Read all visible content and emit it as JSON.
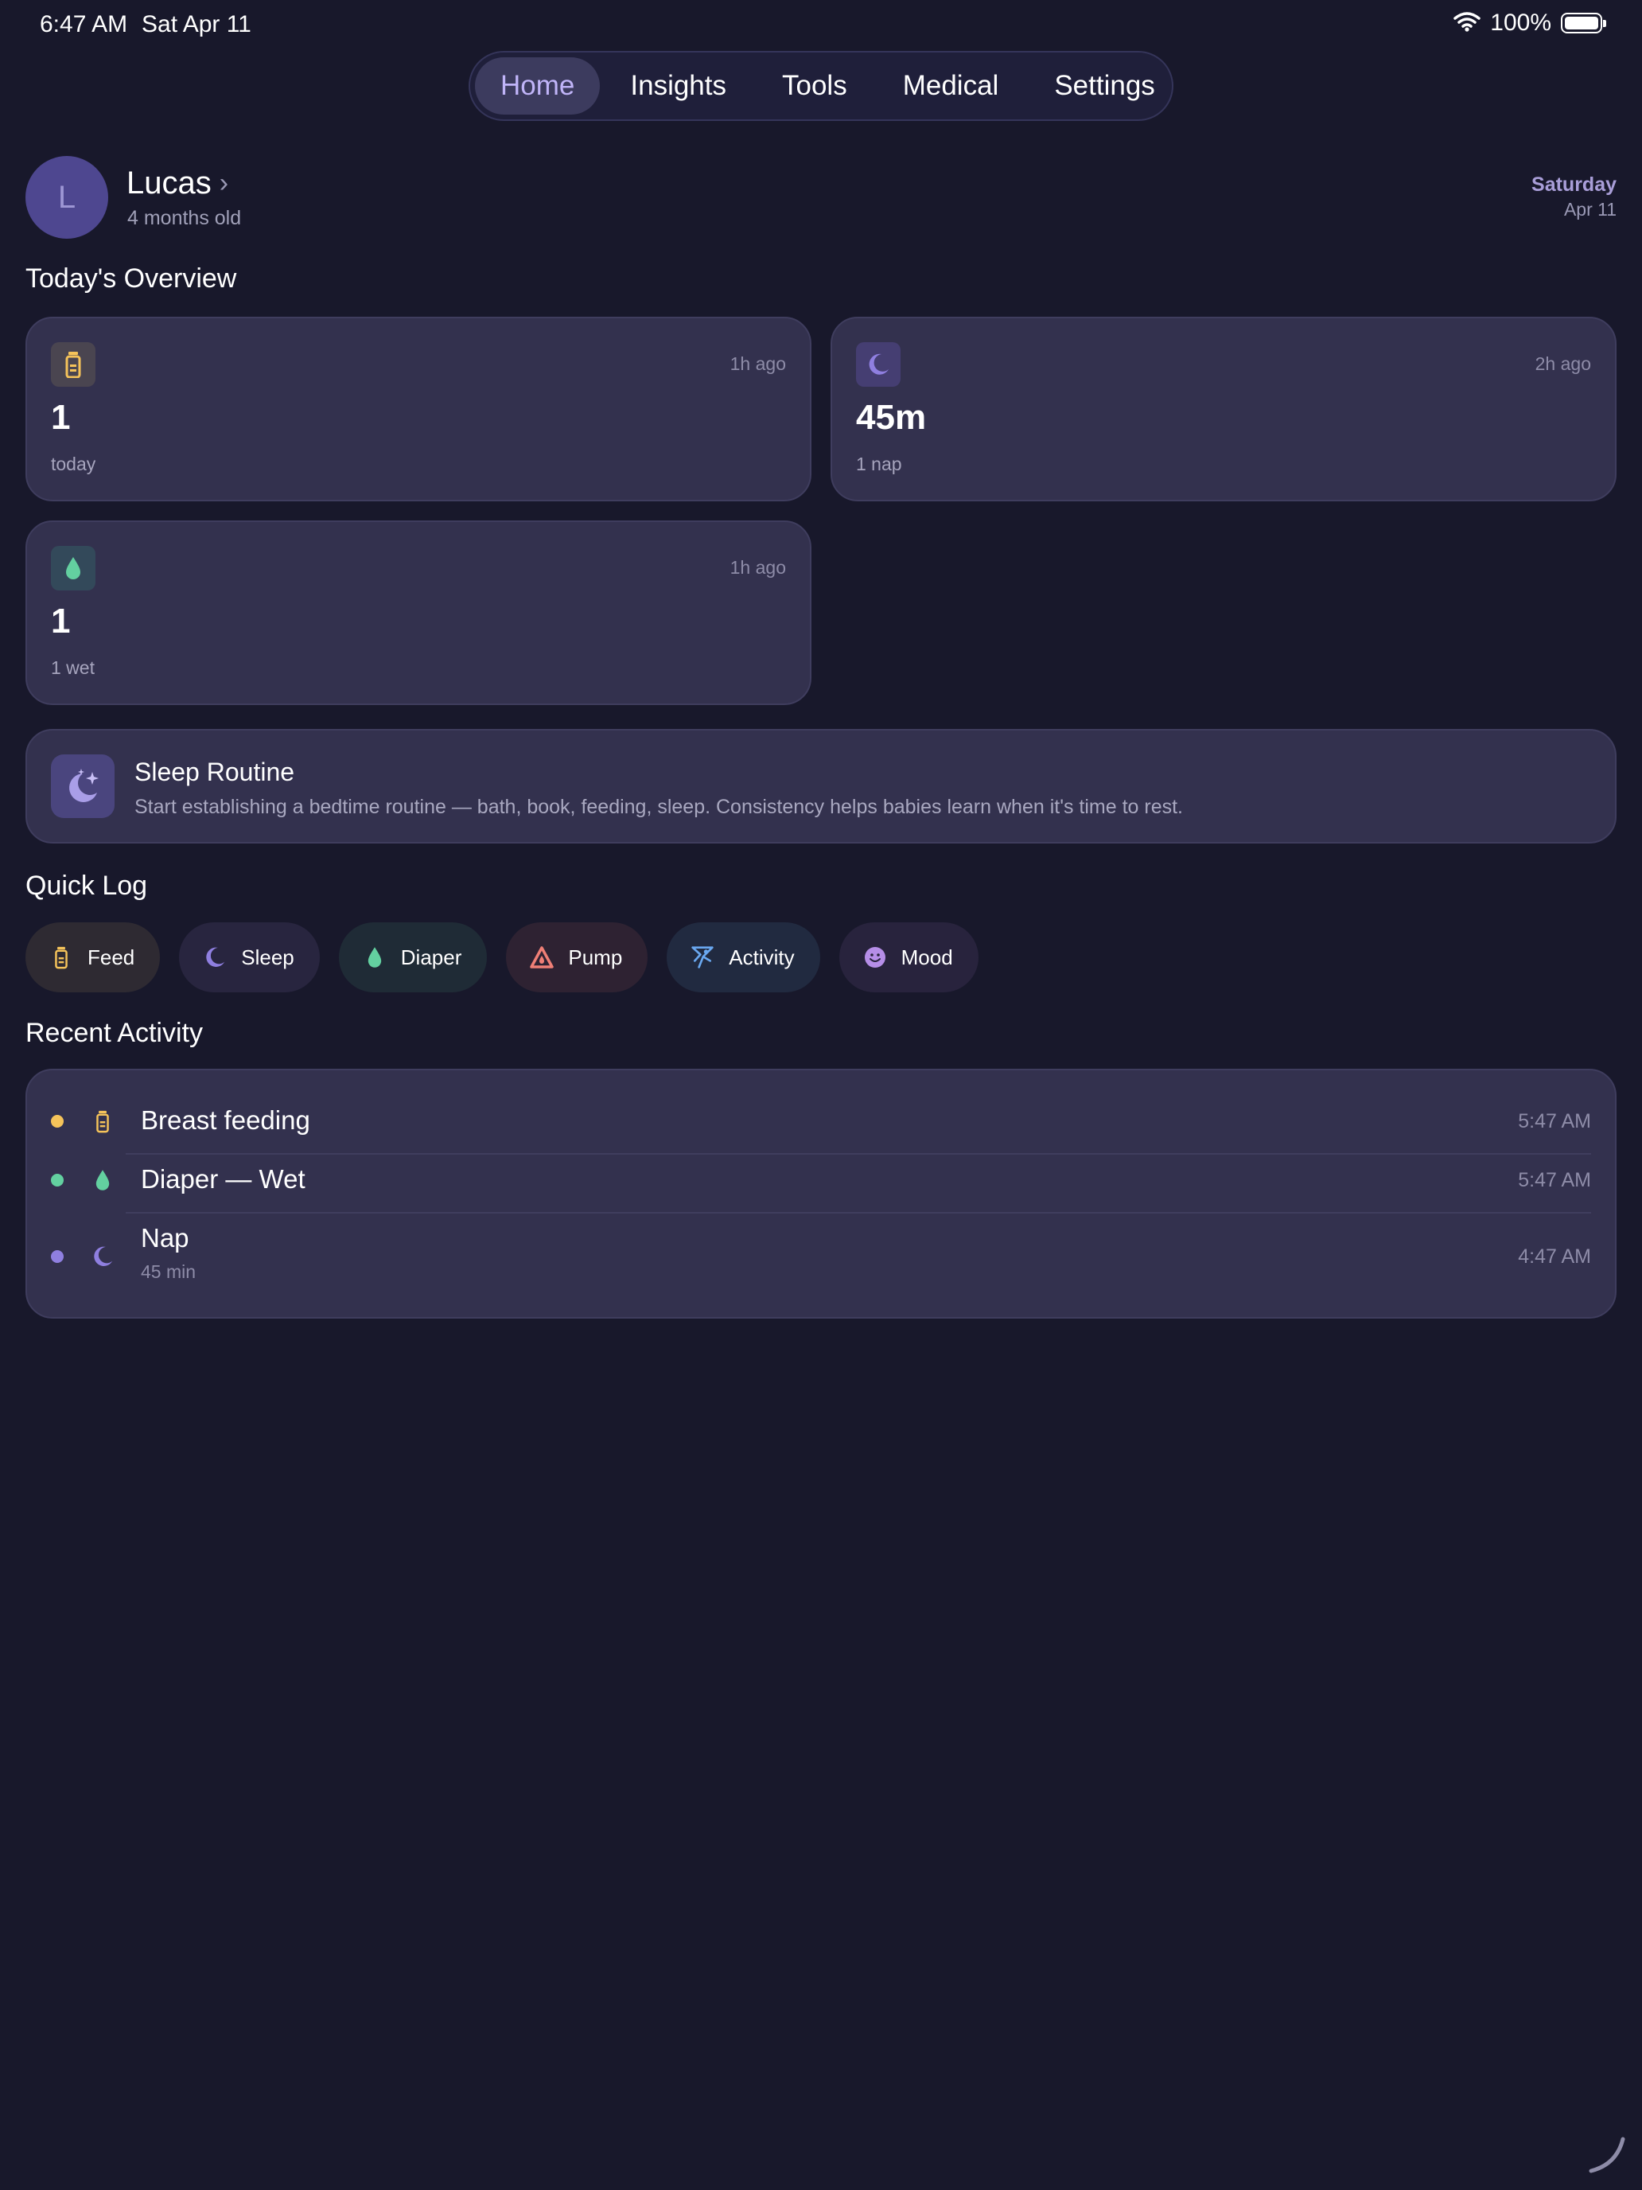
{
  "status": {
    "time": "6:47 AM",
    "date": "Sat Apr 11",
    "battery": "100%"
  },
  "nav": {
    "tabs": [
      "Home",
      "Insights",
      "Tools",
      "Medical",
      "Settings"
    ],
    "active": "Home"
  },
  "profile": {
    "initial": "L",
    "name": "Lucas",
    "age": "4 months old",
    "day": "Saturday",
    "date": "Apr 11"
  },
  "overview": {
    "title": "Today's Overview",
    "feed": {
      "icon": "bottle-icon",
      "ago": "1h ago",
      "value": "1",
      "sub": "today"
    },
    "sleep": {
      "icon": "moon-icon",
      "ago": "2h ago",
      "value": "45m",
      "sub": "1 nap"
    },
    "diaper": {
      "icon": "drop-icon",
      "ago": "1h ago",
      "value": "1",
      "sub": "1 wet"
    }
  },
  "tip": {
    "icon": "moon-stars-icon",
    "title": "Sleep Routine",
    "text": "Start establishing a bedtime routine — bath, book, feeding, sleep. Consistency helps babies learn when it's time to rest."
  },
  "quick_log": {
    "title": "Quick Log",
    "items": [
      {
        "label": "Feed",
        "icon": "bottle-icon"
      },
      {
        "label": "Sleep",
        "icon": "moon-icon"
      },
      {
        "label": "Diaper",
        "icon": "drop-icon"
      },
      {
        "label": "Pump",
        "icon": "pump-icon"
      },
      {
        "label": "Activity",
        "icon": "activity-icon"
      },
      {
        "label": "Mood",
        "icon": "smile-icon"
      }
    ]
  },
  "recent": {
    "title": "Recent Activity",
    "items": [
      {
        "title": "Breast feeding",
        "time": "5:47 AM",
        "icon": "bottle-icon"
      },
      {
        "title": "Diaper — Wet",
        "time": "5:47 AM",
        "icon": "drop-icon"
      },
      {
        "title": "Nap",
        "sub": "45 min",
        "time": "4:47 AM",
        "icon": "moon-icon"
      }
    ]
  },
  "colors": {
    "background": "#18182b",
    "card": "#33314e",
    "accent": "#c0b4f8",
    "feed": "#f5c35a",
    "sleep": "#8f7fe0",
    "diaper": "#63d0a0",
    "pump": "#ef7f76",
    "activity": "#6aa8f0",
    "mood": "#b68ee8"
  }
}
